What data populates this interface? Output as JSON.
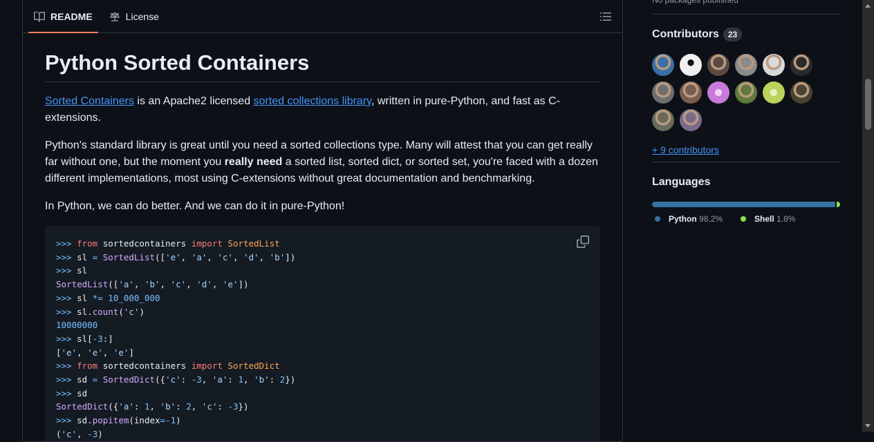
{
  "tabs": {
    "readme_label": "README",
    "license_label": "License",
    "book_icon": "book-icon",
    "law_icon": "law-scale-icon",
    "outline_icon": "list-unordered-icon"
  },
  "readme": {
    "title": "Python Sorted Containers",
    "p1": {
      "link1": "Sorted Containers",
      "text1": " is an Apache2 licensed ",
      "link2": "sorted collections library",
      "text2": ", written in pure-Python, and fast as C-extensions."
    },
    "p2": {
      "text1": "Python's standard library is great until you need a sorted collections type. Many will attest that you can get really far without one, but the moment you ",
      "bold": "really need",
      "text2": " a sorted list, sorted dict, or sorted set, you're faced with a dozen different implementations, most using C-extensions without great documentation and benchmarking."
    },
    "p3": "In Python, we can do better. And we can do it in pure-Python!",
    "copy_icon": "copy-icon",
    "code_lines": [
      ">>> from sortedcontainers import SortedList",
      ">>> sl = SortedList(['e', 'a', 'c', 'd', 'b'])",
      ">>> sl",
      "SortedList(['a', 'b', 'c', 'd', 'e'])",
      ">>> sl *= 10_000_000",
      ">>> sl.count('c')",
      "10000000",
      ">>> sl[-3:]",
      "['e', 'e', 'e']",
      ">>> from sortedcontainers import SortedDict",
      ">>> sd = SortedDict({'c': -3, 'a': 1, 'b': 2})",
      ">>> sd",
      "SortedDict({'a': 1, 'b': 2, 'c': -3})",
      ">>> sd.popitem(index=-1)",
      "('c', -3)"
    ]
  },
  "sidebar": {
    "packages_note": "No packages published",
    "contributors_title": "Contributors",
    "contributors_count": "23",
    "avatar_colors": [
      "#3b6ea5",
      "#f0f0f0",
      "#5a4a42",
      "#8a8a8a",
      "#d9d9d9",
      "#2a2a2a",
      "#6e6e6e",
      "#7a5c4e",
      "#c77ad9",
      "#5e7a3c",
      "#b8d45a",
      "#4a4230",
      "#6a6a5a",
      "#7a6a8a"
    ],
    "more_contributors": "+ 9 contributors",
    "languages_title": "Languages",
    "languages": [
      {
        "name": "Python",
        "percent": "98.2%",
        "value": 98.2,
        "color": "#3572a5"
      },
      {
        "name": "Shell",
        "percent": "1.8%",
        "value": 1.8,
        "color": "#89e051"
      }
    ]
  }
}
